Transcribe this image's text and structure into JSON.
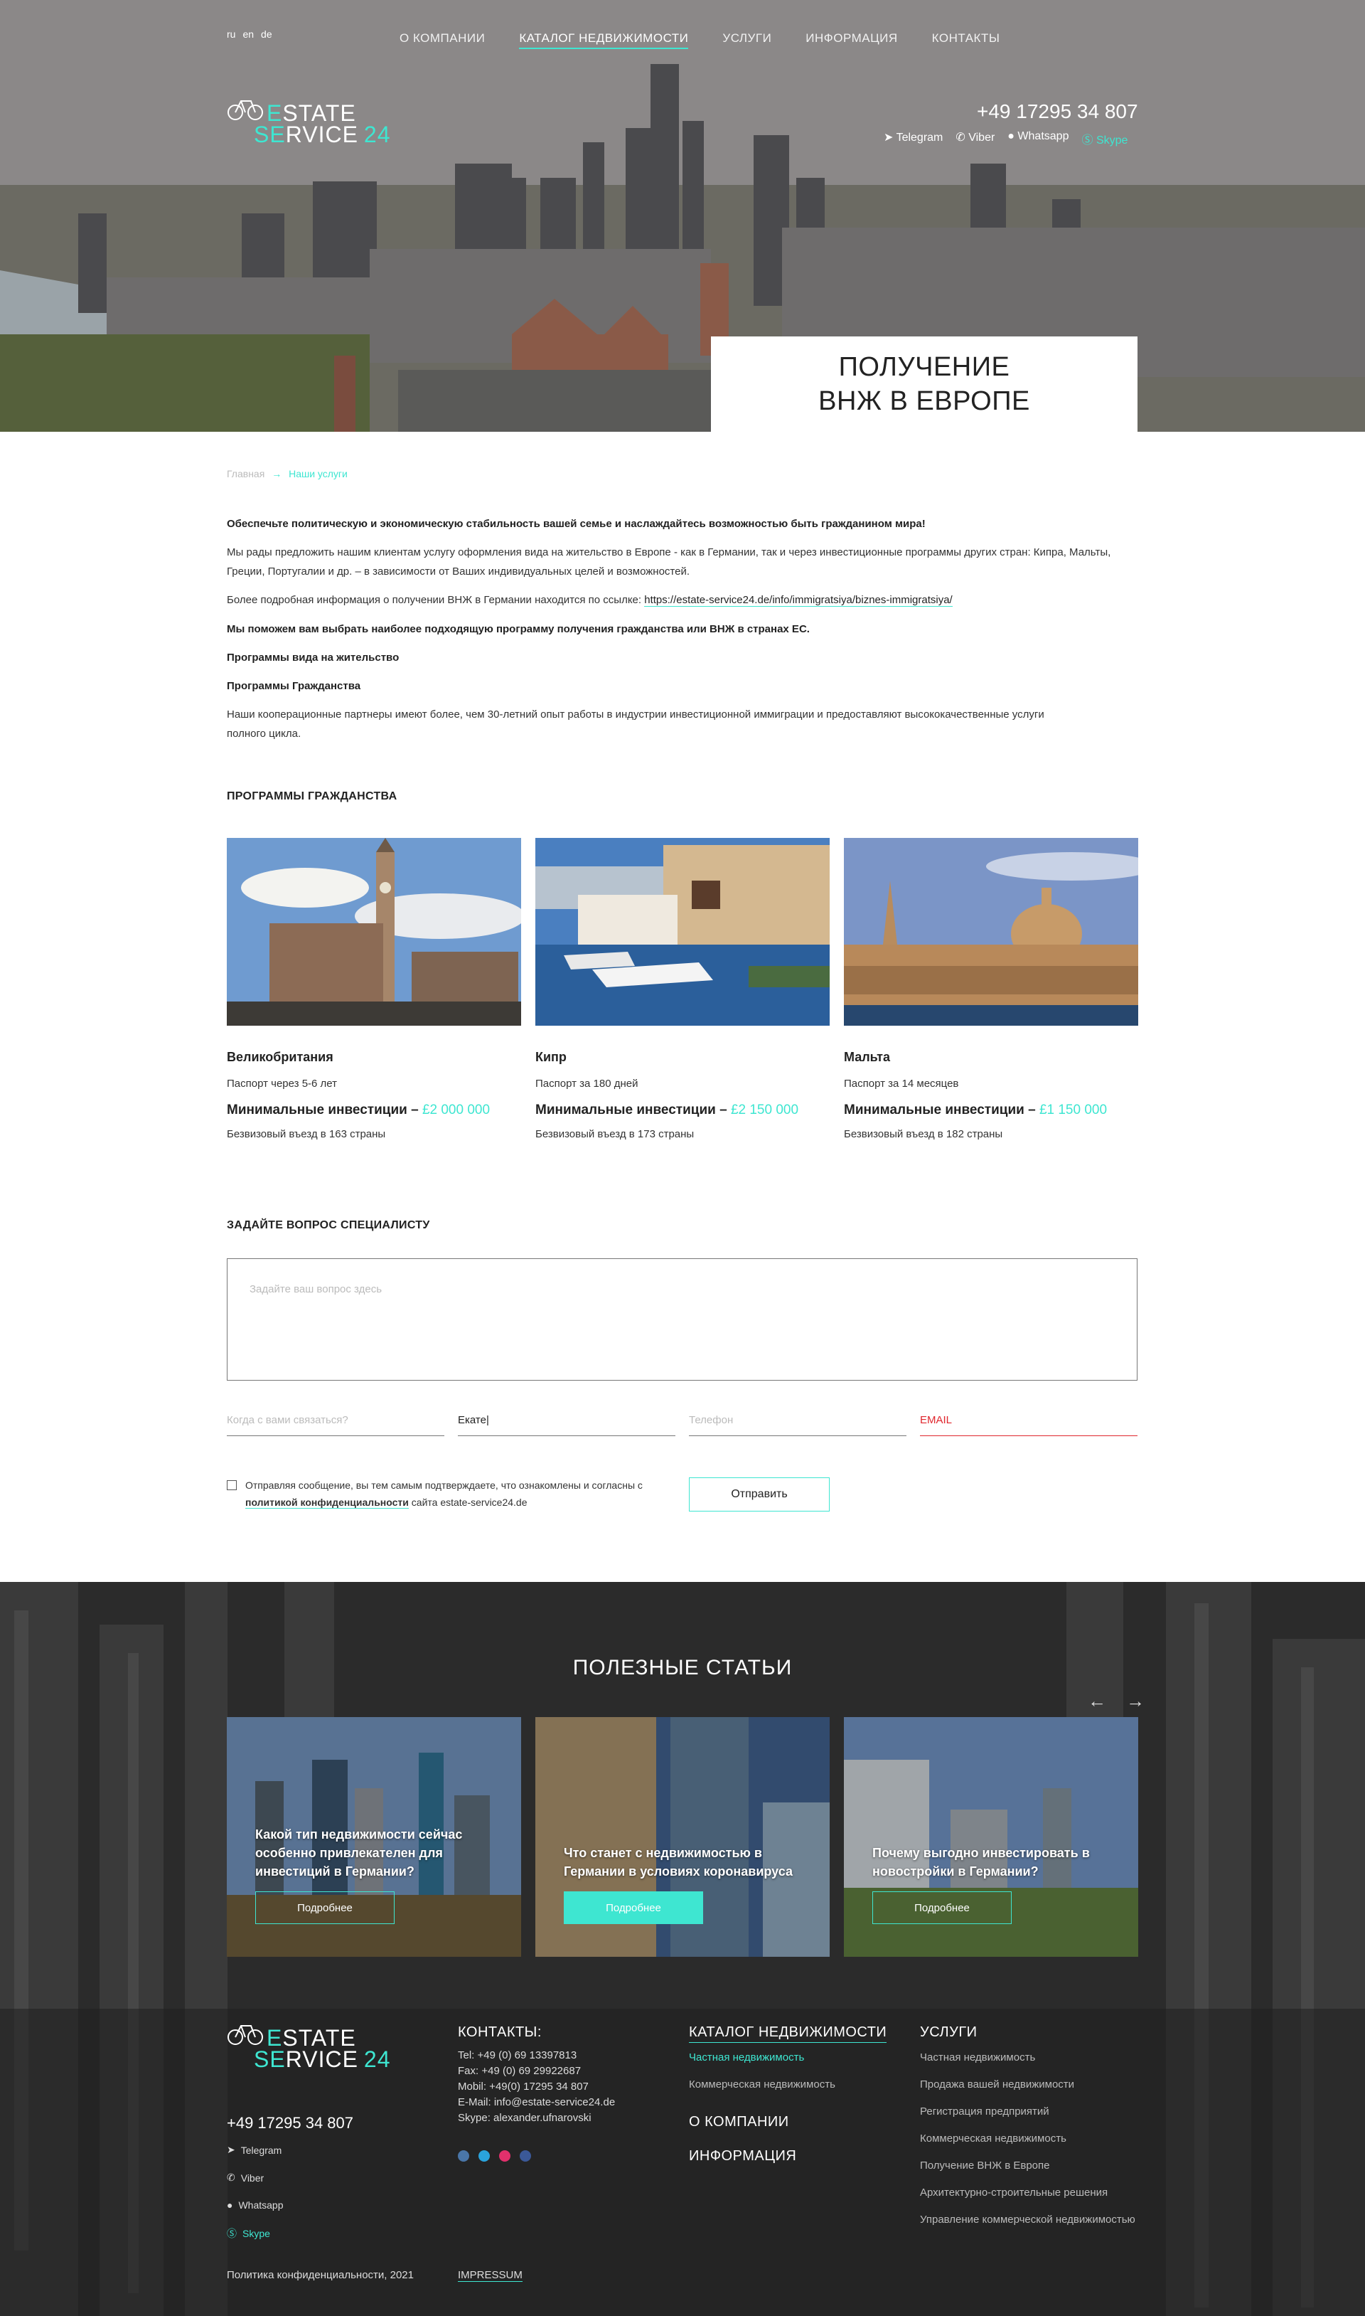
{
  "header": {
    "languages": [
      "ru",
      "en",
      "de"
    ],
    "nav": [
      "О КОМПАНИИ",
      "КАТАЛОГ НЕДВИЖИМОСТИ",
      "УСЛУГИ",
      "ИНФОРМАЦИЯ",
      "КОНТАКТЫ"
    ],
    "nav_active": "КАТАЛОГ НЕДВИЖИМОСТИ",
    "logo": {
      "line1_accent": "E",
      "line1_rest": "STATE",
      "line2_accent": "SE",
      "line2_rest": "RVICE",
      "line2_num": "24"
    },
    "phone": "+49 17295 34 807",
    "messengers": [
      "Telegram",
      "Viber",
      "Whatsapp",
      "Skype"
    ],
    "hero_title_line1": "ПОЛУЧЕНИЕ",
    "hero_title_line2": "ВНЖ В ЕВРОПЕ"
  },
  "breadcrumb": {
    "home": "Главная",
    "sep": "→",
    "current": "Наши услуги"
  },
  "content": {
    "p1": "Обеспечьте политическую и экономическую стабильность вашей семье и наслаждайтесь возможностью быть гражданином мира!",
    "p2": "Мы рады предложить нашим клиентам услугу оформления вида на жительство в Европе - как в Германии, так и через инвестиционные программы других стран: Кипра, Мальты, Греции, Португалии и др. – в зависимости от Ваших индивидуальных целей и возможностей.",
    "p3_text": "Более подробная информация о получении ВНЖ в Германии находится по ссылке: ",
    "p3_link": "https://estate-service24.de/info/immigratsiya/biznes-immigratsiya/",
    "p4": "Мы поможем вам выбрать наиболее подходящую программу получения гражданства или ВНЖ в странах ЕС.",
    "p5": "Программы вида на жительство",
    "p6": "Программы Гражданства",
    "p7": "Наши кооперационные партнеры имеют более, чем 30-летний опыт работы в индустрии инвестиционной иммиграции и предоставляют высококачественные услуги полного цикла."
  },
  "programs": {
    "title": "ПРОГРАММЫ ГРАЖДАНСТВА",
    "cards": [
      {
        "name": "Великобритания",
        "passport": "Паспорт через 5-6 лет",
        "inv_label": "Минимальные инвестиции – ",
        "inv_value": "£2 000 000",
        "visa": "Безвизовый въезд в 163 страны"
      },
      {
        "name": "Кипр",
        "passport": "Паспорт за 180 дней",
        "inv_label": "Минимальные инвестиции – ",
        "inv_value": "£2 150 000",
        "visa": "Безвизовый въезд в 173 страны"
      },
      {
        "name": "Мальта",
        "passport": "Паспорт за 14 месяцев",
        "inv_label": "Минимальные инвестиции – ",
        "inv_value": "£1 150 000",
        "visa": "Безвизовый въезд в 182 страны"
      }
    ]
  },
  "form": {
    "title": "ЗАДАЙТЕ ВОПРОС СПЕЦИАЛИСТУ",
    "question_placeholder": "Задайте ваш вопрос здесь",
    "when_placeholder": "Когда с вами связаться?",
    "name_value": "Екате|",
    "phone_placeholder": "Телефон",
    "email_placeholder": "EMAIL",
    "consent_text": "Отправляя сообщение, вы тем самым подтверждаете, что ознакомлены и согласны с ",
    "consent_link": "политикой конфиденциальности",
    "consent_tail": " сайта estate-service24.de",
    "submit": "Отправить"
  },
  "articles": {
    "title": "ПОЛЕЗНЫЕ СТАТЬИ",
    "prev": "←",
    "next": "→",
    "items": [
      {
        "caption": "Какой тип недвижимости сейчас особенно привлекателен для инвестиций в Германии?",
        "button": "Подробнее"
      },
      {
        "caption": "Что станет с недвижимостью в Германии в условиях коронавируса",
        "button": "Подробнее"
      },
      {
        "caption": "Почему выгодно инвестировать в новостройки в Германии?",
        "button": "Подробнее"
      }
    ]
  },
  "footer": {
    "phone": "+49 17295 34 807",
    "messengers": [
      "Telegram",
      "Viber",
      "Whatsapp",
      "Skype"
    ],
    "contacts_title": "КОНТАКТЫ:",
    "contacts": [
      "Tel: +49 (0) 69 13397813",
      "Fax: +49 (0) 69 29922687",
      "Mobil: +49(0) 17295 34 807",
      "E-Mail: info@estate-service24.de",
      "Skype: alexander.ufnarovski"
    ],
    "catalog_title": "КАТАЛОГ НЕДВИЖИМОСТИ",
    "catalog_items": [
      "Частная недвижимость",
      "Коммерческая недвижимость"
    ],
    "about": "О КОМПАНИИ",
    "info": "ИНФОРМАЦИЯ",
    "services_title": "УСЛУГИ",
    "services_items": [
      "Частная недвижимость",
      "Продажа вашей недвижимости",
      "Регистрация предприятий",
      "Коммерческая недвижимость",
      "Получение ВНЖ в Европе",
      "Архитектурно-строительные решения",
      "Управление коммерческой недвижимостью"
    ],
    "copyright": "Политика конфиденциальности, 2021",
    "impressum": "IMPRESSUM"
  },
  "colors": {
    "accent": "#3ee6d1",
    "error": "#e0262d",
    "dark_bg": "#2a2a2a"
  }
}
